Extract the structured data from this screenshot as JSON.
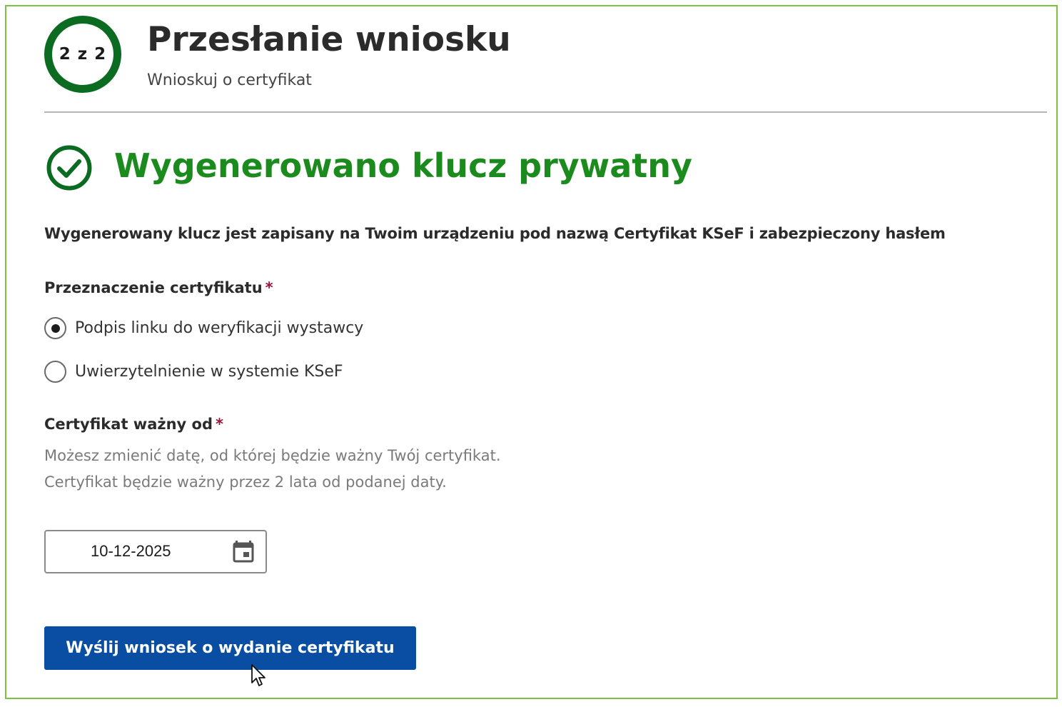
{
  "header": {
    "step_indicator": "2 z 2",
    "title": "Przesłanie wniosku",
    "subtitle": "Wnioskuj o certyfikat"
  },
  "success": {
    "icon": "check-circle-icon",
    "title": "Wygenerowano klucz prywatny",
    "message": "Wygenerowany klucz jest zapisany na Twoim urządzeniu pod nazwą Certyfikat KSeF i zabezpieczony hasłem"
  },
  "form": {
    "purpose": {
      "label": "Przeznaczenie certyfikatu",
      "required_mark": "*",
      "options": [
        {
          "label": "Podpis linku do weryfikacji wystawcy",
          "selected": true
        },
        {
          "label": "Uwierzytelnienie w systemie KSeF",
          "selected": false
        }
      ]
    },
    "valid_from": {
      "label": "Certyfikat ważny od",
      "required_mark": "*",
      "hint": "Możesz zmienić datę, od której będzie ważny Twój certyfikat. Certyfikat będzie ważny przez 2 lata od podanej daty.",
      "value": "10-12-2025",
      "icon": "calendar-icon"
    },
    "submit_label": "Wyślij wniosek o wydanie certyfikatu"
  },
  "colors": {
    "frame_border": "#7cc242",
    "step_ring": "#0b6b21",
    "success_green": "#1b8b1e",
    "required_red": "#a0123a",
    "primary_button": "#0a4ea3"
  }
}
